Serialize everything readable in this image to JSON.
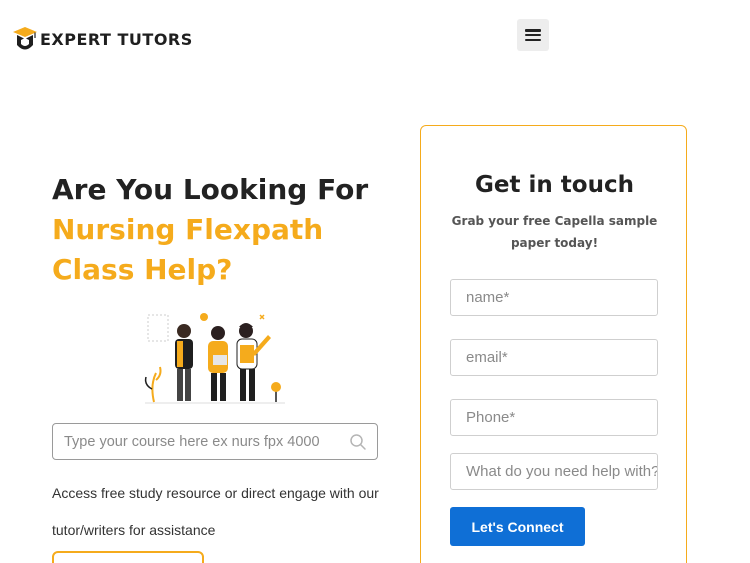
{
  "brand": {
    "name": "EXPERT TUTORS",
    "accent_color": "#f5ab1c",
    "button_color": "#0f6fd6"
  },
  "header": {
    "menu_icon": "hamburger-menu-icon"
  },
  "hero": {
    "headline_line1": "Are You Looking For",
    "headline_line2": "Nursing Flexpath",
    "headline_line3": "Class Help?"
  },
  "search": {
    "placeholder": "Type your course here ex nurs fpx 4000",
    "icon": "search-icon"
  },
  "description": "Access free study resource or direct engage with our tutor/writers for assistance",
  "contact_card": {
    "title": "Get in touch",
    "subtitle": "Grab your free Capella sample paper today!",
    "fields": {
      "name_placeholder": "name*",
      "email_placeholder": "email*",
      "phone_placeholder": "Phone*",
      "help_placeholder": "What do you need help with?"
    },
    "submit_label": "Let's Connect"
  }
}
